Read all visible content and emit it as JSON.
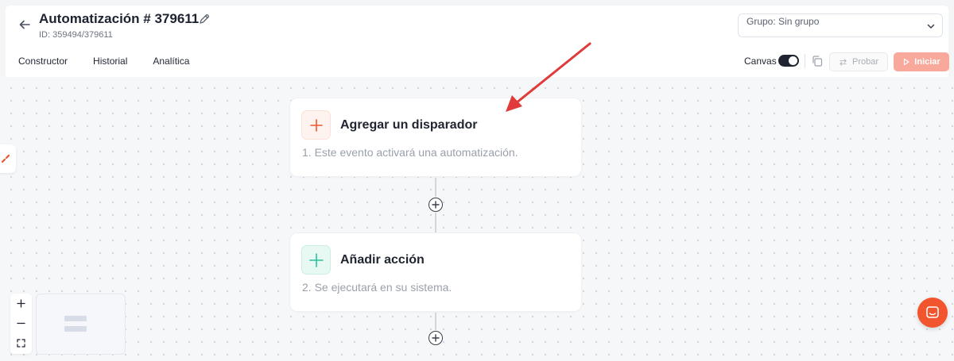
{
  "header": {
    "title": "Automatización # 379611",
    "id_label": "ID: 359494/379611",
    "group_select": {
      "value": "Grupo: Sin grupo"
    }
  },
  "tabs": [
    {
      "label": "Constructor"
    },
    {
      "label": "Historial"
    },
    {
      "label": "Analítica"
    }
  ],
  "toolbar": {
    "canvas_label": "Canvas",
    "canvas_enabled": true,
    "probar_label": "Probar",
    "iniciar_label": "Iniciar"
  },
  "flow": {
    "trigger": {
      "title": "Agregar un disparador",
      "description": "1. Este evento activará una automatización."
    },
    "action": {
      "title": "Añadir acción",
      "description": "2. Se ejecutará en su sistema."
    }
  },
  "colors": {
    "accent": "#f2542d",
    "trigger_icon": "#f2542d",
    "action_icon": "#2bbfa0",
    "iniciar_disabled": "#f8a99b",
    "annotation_arrow": "#e03a3a"
  }
}
